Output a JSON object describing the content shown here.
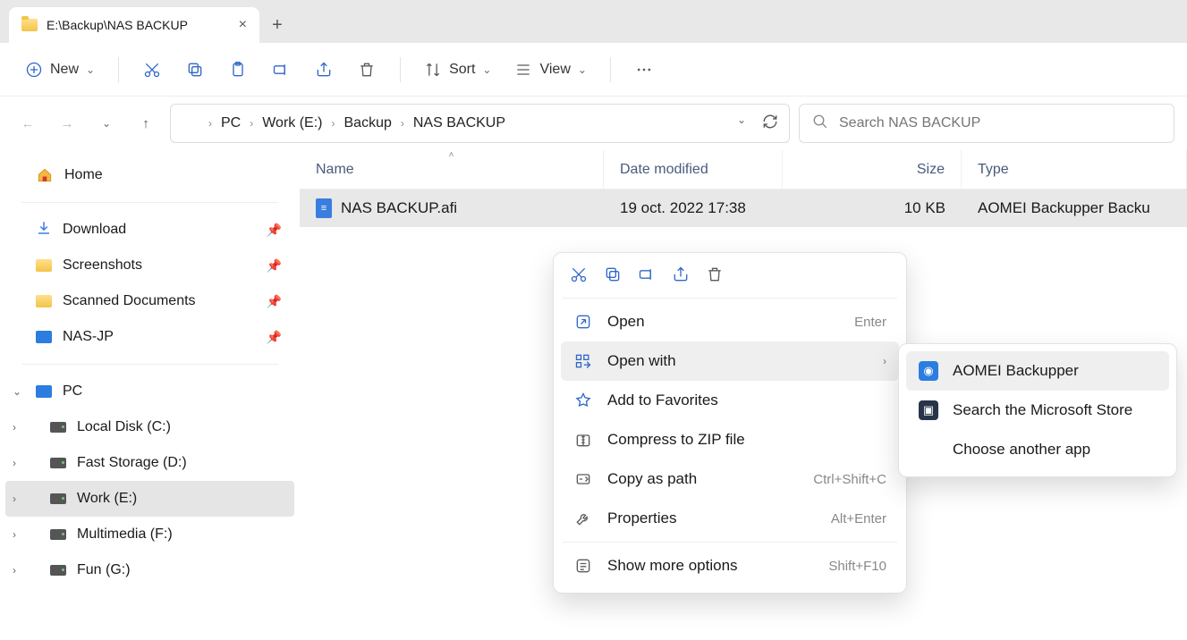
{
  "tab": {
    "title": "E:\\Backup\\NAS BACKUP"
  },
  "toolbar": {
    "new": "New",
    "sort": "Sort",
    "view": "View"
  },
  "breadcrumb": [
    "PC",
    "Work (E:)",
    "Backup",
    "NAS BACKUP"
  ],
  "search": {
    "placeholder": "Search NAS BACKUP"
  },
  "sidebar": {
    "home": "Home",
    "quick": [
      {
        "label": "Download"
      },
      {
        "label": "Screenshots"
      },
      {
        "label": "Scanned Documents"
      },
      {
        "label": "NAS-JP"
      }
    ],
    "pc": "PC",
    "drives": [
      {
        "label": "Local Disk (C:)"
      },
      {
        "label": "Fast Storage (D:)"
      },
      {
        "label": "Work (E:)",
        "selected": true
      },
      {
        "label": "Multimedia (F:)"
      },
      {
        "label": "Fun (G:)"
      }
    ]
  },
  "columns": {
    "name": "Name",
    "date": "Date modified",
    "size": "Size",
    "type": "Type"
  },
  "files": [
    {
      "name": "NAS BACKUP.afi",
      "date": "19 oct. 2022 17:38",
      "size": "10 KB",
      "type": "AOMEI Backupper Backu"
    }
  ],
  "ctx": {
    "open": "Open",
    "open_sc": "Enter",
    "openwith": "Open with",
    "fav": "Add to Favorites",
    "zip": "Compress to ZIP file",
    "copypath": "Copy as path",
    "copypath_sc": "Ctrl+Shift+C",
    "props": "Properties",
    "props_sc": "Alt+Enter",
    "more": "Show more options",
    "more_sc": "Shift+F10"
  },
  "submenu": {
    "aomei": "AOMEI Backupper",
    "msstore": "Search the Microsoft Store",
    "choose": "Choose another app"
  }
}
